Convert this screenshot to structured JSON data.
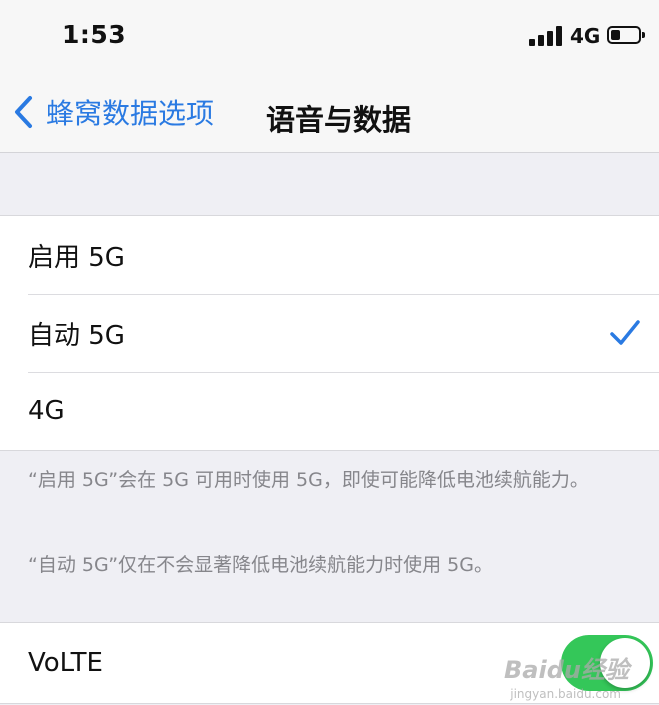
{
  "status_bar": {
    "time": "1:53",
    "network": "4G",
    "signal_bars": 4,
    "battery_level": 0.35
  },
  "nav": {
    "back_label": "蜂窝数据选项",
    "title": "语音与数据"
  },
  "options": [
    {
      "label": "启用 5G",
      "selected": false
    },
    {
      "label": "自动 5G",
      "selected": true
    },
    {
      "label": "4G",
      "selected": false
    }
  ],
  "footer": {
    "note1": "“启用 5G”会在 5G 可用时使用 5G，即使可能降低电池续航能力。",
    "note2": "“自动 5G”仅在不会显著降低电池续航能力时使用 5G。"
  },
  "volte": {
    "label": "VoLTE",
    "enabled": true
  },
  "watermark": {
    "brand": "Baidu经验",
    "url": "jingyan.baidu.com"
  },
  "colors": {
    "accent": "#2a7ae2",
    "toggle_on": "#34c759",
    "background": "#efeff4"
  }
}
